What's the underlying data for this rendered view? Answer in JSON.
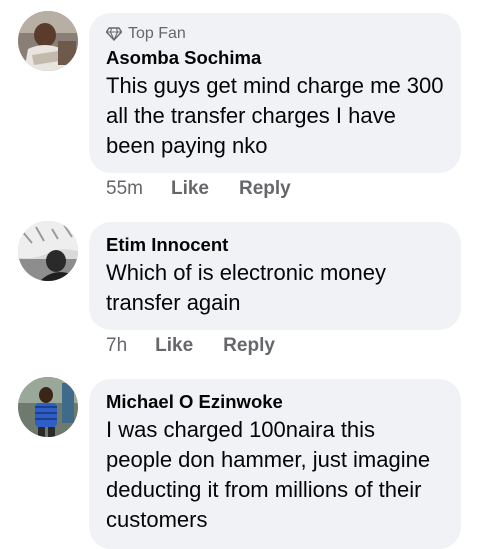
{
  "comments": [
    {
      "badge": "Top Fan",
      "author": "Asomba Sochima",
      "text": "This guys get mind charge me 300 all the transfer charges I have been paying nko",
      "time": "55m",
      "like_label": "Like",
      "reply_label": "Reply"
    },
    {
      "author": "Etim Innocent",
      "text": "Which of is electronic money transfer again",
      "time": "7h",
      "like_label": "Like",
      "reply_label": "Reply"
    },
    {
      "author": "Michael O Ezinwoke",
      "text": "I was charged 100naira this people don hammer, just imagine deducting it from millions of their customers"
    }
  ],
  "colors": {
    "bubble": "#f0f2f5",
    "meta_text": "#65676b",
    "body_text": "#050505"
  },
  "icons": {
    "top_fan": "diamond-icon"
  }
}
